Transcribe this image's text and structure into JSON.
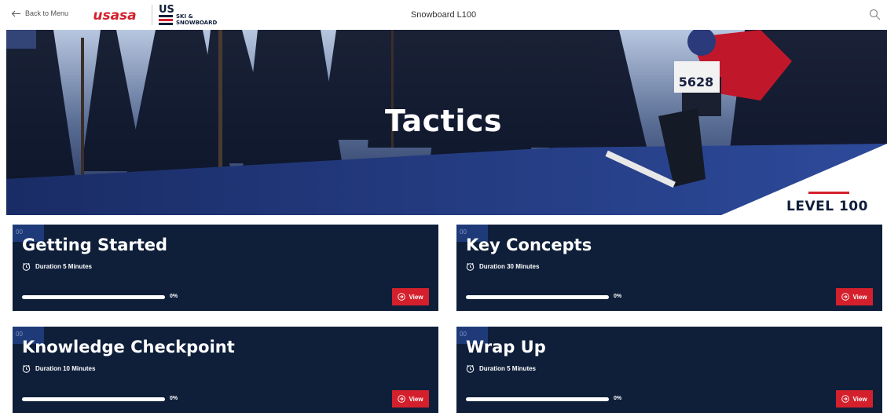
{
  "header": {
    "back_label": "Back to Menu",
    "logo_usasa": "usasa",
    "logo_us": "US",
    "logo_us_line1": "SKI &",
    "logo_us_line2": "SNOWBOARD",
    "page_title": "Snowboard L100"
  },
  "hero": {
    "title": "Tactics",
    "level_label": "LEVEL 100",
    "bib_number": "5628"
  },
  "colors": {
    "navy": "#0f1f3a",
    "accent_red": "#d4202c",
    "tag_blue": "#1f3a78"
  },
  "cards": [
    {
      "title": "Getting Started",
      "duration": "Duration 5 Minutes",
      "progress_pct": 0,
      "progress_label": "0%",
      "view_label": "View",
      "tag": "00"
    },
    {
      "title": "Key Concepts",
      "duration": "Duration 30 Minutes",
      "progress_pct": 0,
      "progress_label": "0%",
      "view_label": "View",
      "tag": "00"
    },
    {
      "title": "Knowledge Checkpoint",
      "duration": "Duration 10 Minutes",
      "progress_pct": 0,
      "progress_label": "0%",
      "view_label": "View",
      "tag": "00"
    },
    {
      "title": "Wrap Up",
      "duration": "Duration 5 Minutes",
      "progress_pct": 0,
      "progress_label": "0%",
      "view_label": "View",
      "tag": "00"
    }
  ],
  "icons": {
    "back": "arrow-left-icon",
    "search": "search-icon",
    "duration": "clock-icon",
    "view": "arrow-circle-right-icon"
  }
}
